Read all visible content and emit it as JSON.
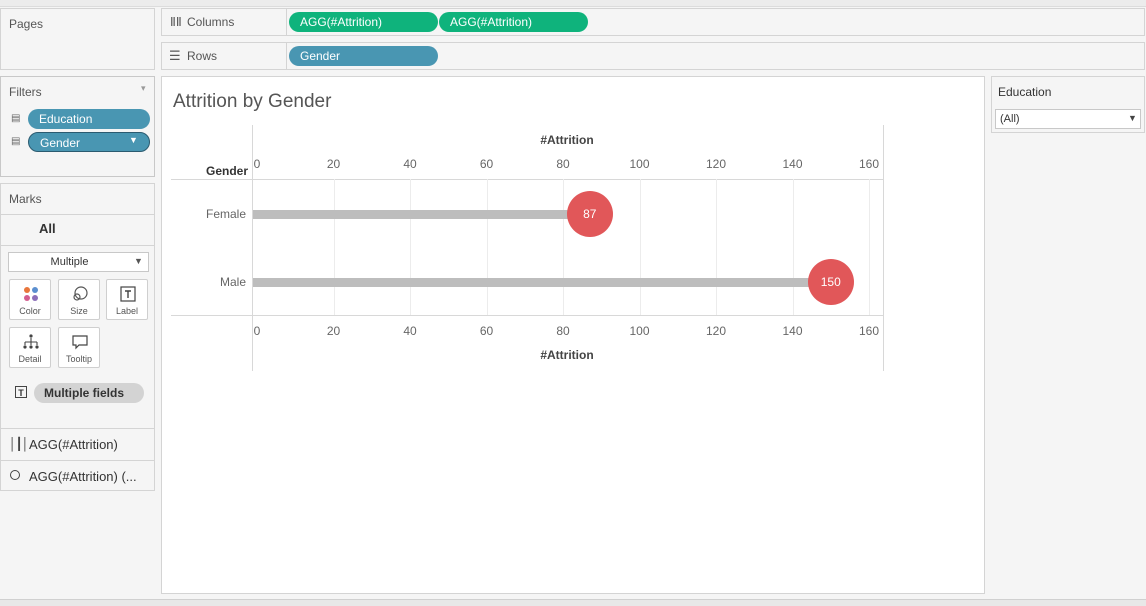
{
  "shelves": {
    "pages_label": "Pages",
    "columns_label": "Columns",
    "columns_pills": [
      "AGG(#Attrition)",
      "AGG(#Attrition)"
    ],
    "rows_label": "Rows",
    "rows_pills": [
      "Gender"
    ]
  },
  "filters": {
    "title": "Filters",
    "items": [
      "Education",
      "Gender"
    ]
  },
  "marks": {
    "title": "Marks",
    "all_label": "All",
    "mark_type": "Multiple",
    "cards": [
      "Color",
      "Size",
      "Label",
      "Detail",
      "Tooltip"
    ],
    "field_pill": "Multiple fields",
    "measures": [
      "AGG(#Attrition)",
      "AGG(#Attrition) (..."
    ]
  },
  "quick_filter": {
    "title": "Education",
    "value": "(All)"
  },
  "colors": {
    "pill_green": "#0fb37c",
    "pill_blue": "#4996b2",
    "bar": "#bdbdbd",
    "circle": "#e15759"
  },
  "chart_data": {
    "type": "bar",
    "title": "Attrition by Gender",
    "row_header": "Gender",
    "xlabel": "#Attrition",
    "categories": [
      "Female",
      "Male"
    ],
    "values": [
      87,
      150
    ],
    "data_labels": [
      "87",
      "150"
    ],
    "xlim": [
      0,
      160
    ],
    "ticks": [
      0,
      20,
      40,
      60,
      80,
      100,
      120,
      140,
      160
    ],
    "mark_style": "lollipop: gray bar with red circle end labeled by value",
    "grid": true,
    "axes": [
      "top",
      "bottom"
    ]
  }
}
